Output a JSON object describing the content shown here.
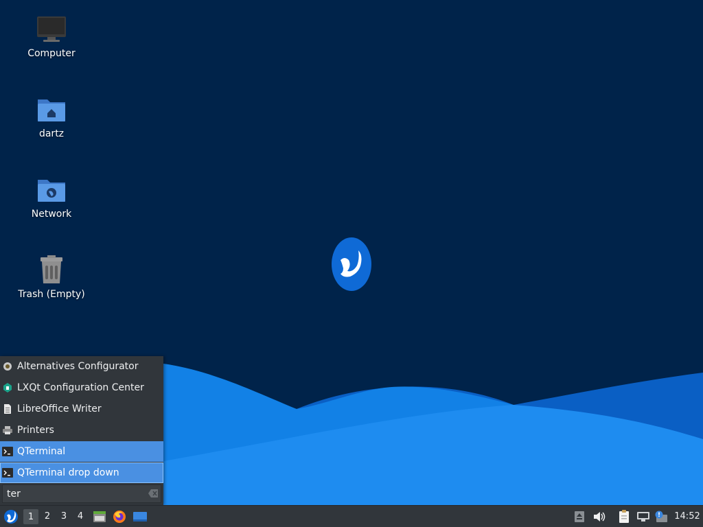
{
  "desktop": {
    "icons": [
      {
        "label": "Computer",
        "icon": "computer-icon"
      },
      {
        "label": "dartz",
        "icon": "home-folder-icon"
      },
      {
        "label": "Network",
        "icon": "network-folder-icon"
      },
      {
        "label": "Trash (Empty)",
        "icon": "trash-icon"
      }
    ],
    "colors": {
      "background": "#00234a",
      "wave_light": "#1e8cf0",
      "wave_dark": "#0a5fc4"
    }
  },
  "menu": {
    "items": [
      {
        "label": "Alternatives Configurator",
        "icon": "alternatives-icon"
      },
      {
        "label": "LXQt Configuration Center",
        "icon": "lxqt-config-icon"
      },
      {
        "label": "LibreOffice Writer",
        "icon": "document-icon"
      },
      {
        "label": "Printers",
        "icon": "printer-icon"
      },
      {
        "label": "QTerminal",
        "icon": "terminal-icon"
      },
      {
        "label": "QTerminal drop down",
        "icon": "terminal-icon"
      }
    ],
    "search": {
      "value": "ter"
    }
  },
  "taskbar": {
    "desktops": [
      "1",
      "2",
      "3",
      "4"
    ],
    "active_desktop": "1",
    "quicklaunch": [
      "file-manager-icon",
      "firefox-icon",
      "show-desktop-icon"
    ],
    "tray": [
      "updates-icon",
      "volume-icon",
      "clipboard-icon",
      "network-icon",
      "notification-icon"
    ],
    "clock": "14:52"
  }
}
